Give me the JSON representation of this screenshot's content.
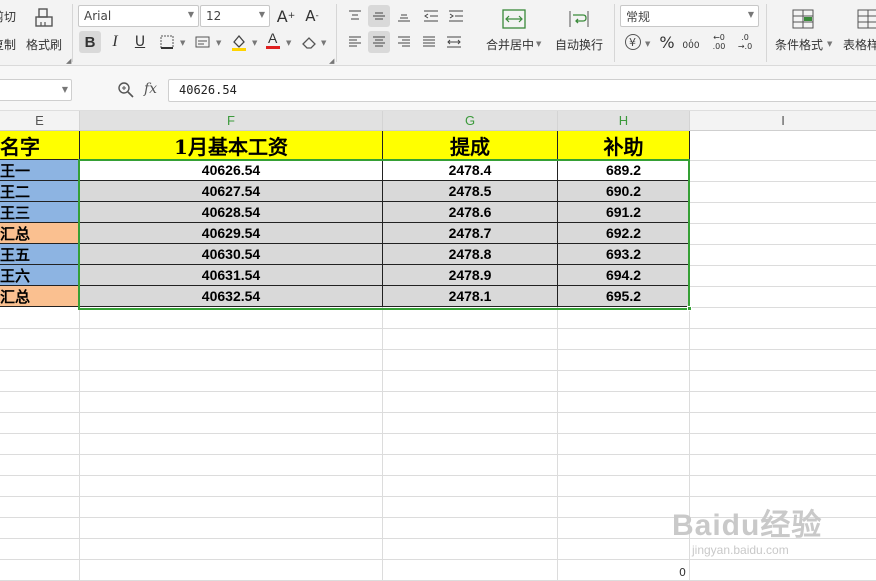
{
  "toolbar": {
    "cut_label": "剪切",
    "copy_label": "复制",
    "format_painter_label": "格式刷",
    "font_name": "Arial",
    "font_size": "12",
    "bold": "B",
    "italic": "I",
    "underline": "U",
    "merge_center_label": "合并居中",
    "auto_wrap_label": "自动换行",
    "number_format": "常规",
    "currency_symbol": "¥",
    "percent_symbol": "%",
    "thousands_symbol": "000",
    "increase_decimal_label": ".00 → .0",
    "decrease_decimal_label": ".0 → .00",
    "conditional_format_label": "条件格式",
    "table_style_label": "表格样"
  },
  "formula_bar": {
    "name_box": "",
    "fx_label": "fx",
    "value": "40626.54"
  },
  "columns": [
    {
      "id": "E",
      "label": "E"
    },
    {
      "id": "F",
      "label": "F"
    },
    {
      "id": "G",
      "label": "G"
    },
    {
      "id": "H",
      "label": "H"
    },
    {
      "id": "I",
      "label": "I"
    }
  ],
  "sheet": {
    "headers": {
      "name": "名字",
      "salary": "1月基本工资",
      "commission": "提成",
      "subsidy": "补助"
    },
    "rows": [
      {
        "name": "王一",
        "salary": "40626.54",
        "commission": "2478.4",
        "subsidy": "689.2",
        "color": "#8db4e2"
      },
      {
        "name": "王二",
        "salary": "40627.54",
        "commission": "2478.5",
        "subsidy": "690.2",
        "color": "#8db4e2"
      },
      {
        "name": "王三",
        "salary": "40628.54",
        "commission": "2478.6",
        "subsidy": "691.2",
        "color": "#8db4e2"
      },
      {
        "name": "汇总",
        "salary": "40629.54",
        "commission": "2478.7",
        "subsidy": "692.2",
        "color": "#fac090"
      },
      {
        "name": "王五",
        "salary": "40630.54",
        "commission": "2478.8",
        "subsidy": "693.2",
        "color": "#8db4e2"
      },
      {
        "name": "王六",
        "salary": "40631.54",
        "commission": "2478.9",
        "subsidy": "694.2",
        "color": "#8db4e2"
      },
      {
        "name": "汇总",
        "salary": "40632.54",
        "commission": "2478.1",
        "subsidy": "695.2",
        "color": "#fac090"
      }
    ]
  },
  "status": {
    "bottom_value": "0"
  },
  "watermark": {
    "brand": "Baidu经验",
    "url": "jingyan.baidu.com"
  },
  "colors": {
    "header_fill": "#ffff00",
    "selection": "#35a035",
    "accent_blue": "#8db4e2",
    "accent_orange": "#fac090"
  }
}
